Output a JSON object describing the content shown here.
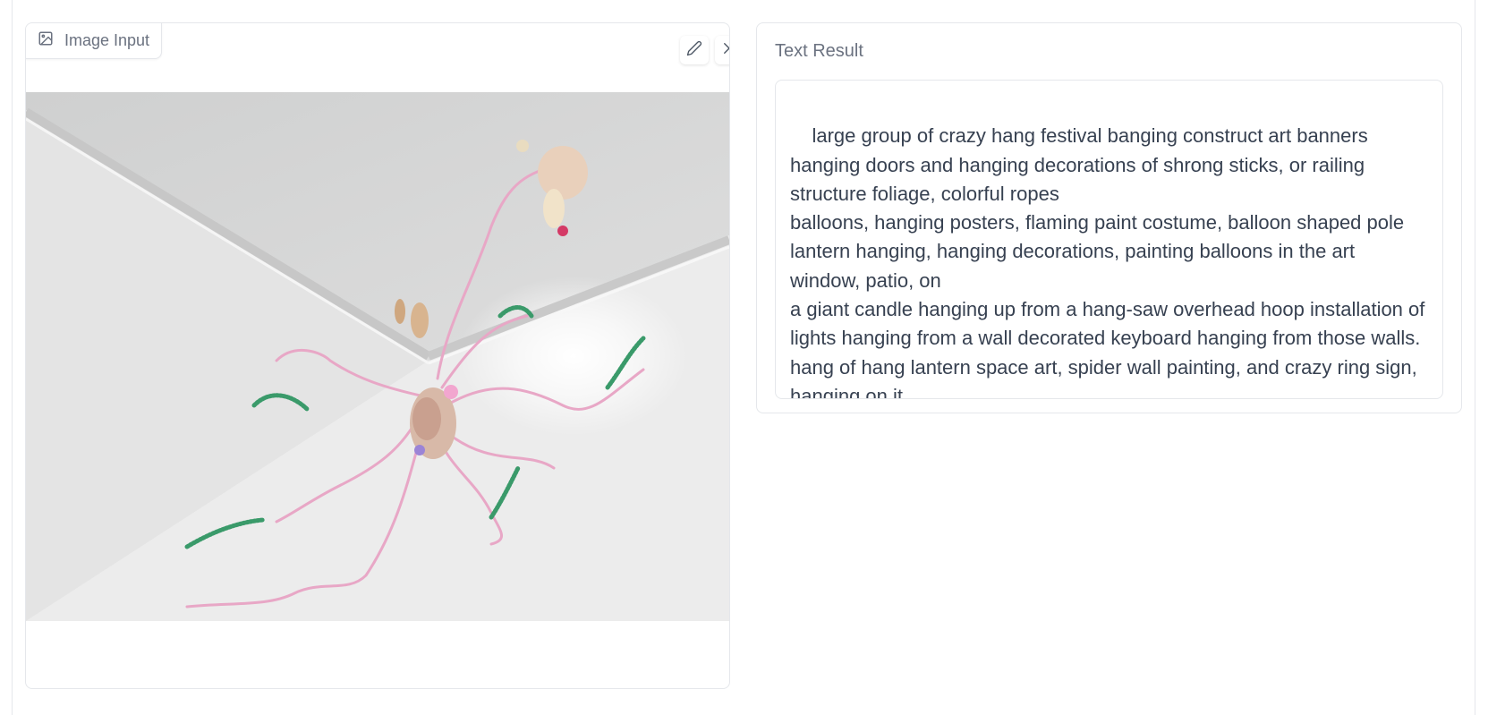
{
  "image_input": {
    "label": "Image Input",
    "edit_tooltip": "Edit",
    "clear_tooltip": "Clear",
    "image_alt": "Ceiling corner art installation with pink ropes, green pipe cleaners and hanging knotted sculptures"
  },
  "text_result": {
    "label": "Text Result",
    "value": "large group of crazy hang festival banging construct art banners hanging doors and hanging decorations of shrong sticks, or railing structure foliage, colorful ropes\nballoons, hanging posters, flaming paint costume, balloon shaped pole lantern hanging, hanging decorations, painting balloons in the art window, patio, on\na giant candle hanging up from a hang-saw overhead hoop installation of lights hanging from a wall decorated keyboard hanging from those walls. hang of hang lantern space art, spider wall painting, and crazy ring sign, hanging on it"
  },
  "icons": [
    "image-icon",
    "pencil-icon",
    "close-icon",
    "resize-handle-icon"
  ],
  "colors": {
    "border": "#e5e7eb",
    "label_text": "#6b7280",
    "body_text": "#374151"
  }
}
